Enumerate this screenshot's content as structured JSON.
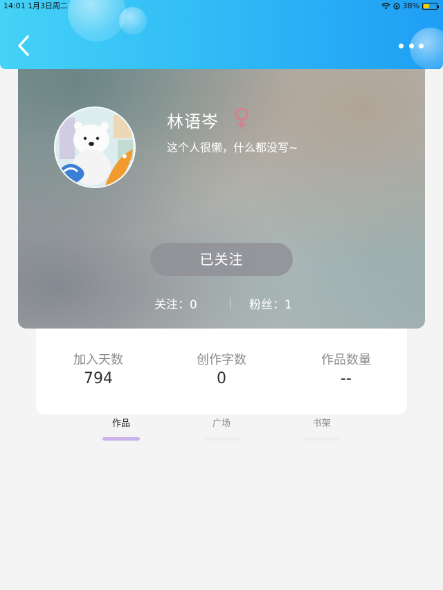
{
  "status_bar": {
    "time": "14:01",
    "date": "1月3日周二",
    "battery_percent": "38%",
    "battery_level": 0.38
  },
  "header": {
    "back_icon": "chevron-left-icon",
    "more_icon": "more-horizontal-icon",
    "colors": {
      "gradient_start": "#45d2f6",
      "gradient_end": "#1f9ef5"
    }
  },
  "profile": {
    "name": "林语岑",
    "gender_icon": "female-symbol-icon",
    "gender_color": "#e07a8a",
    "bio": "这个人很懒，什么都没写~",
    "follow_button": "已关注",
    "following": "关注：0",
    "fans": "粉丝：1"
  },
  "info": {
    "days_label": "加入天数",
    "days_value": "794",
    "words_label": "创作字数",
    "words_value": "0",
    "works_label": "作品数量",
    "works_value": "--"
  },
  "tabs": [
    {
      "label": "作品",
      "active": true,
      "bar_color": "#c9b3ea"
    },
    {
      "label": "广场",
      "active": false,
      "bar_color": "#eeeef0"
    },
    {
      "label": "书架",
      "active": false,
      "bar_color": "#eeeef0"
    }
  ]
}
